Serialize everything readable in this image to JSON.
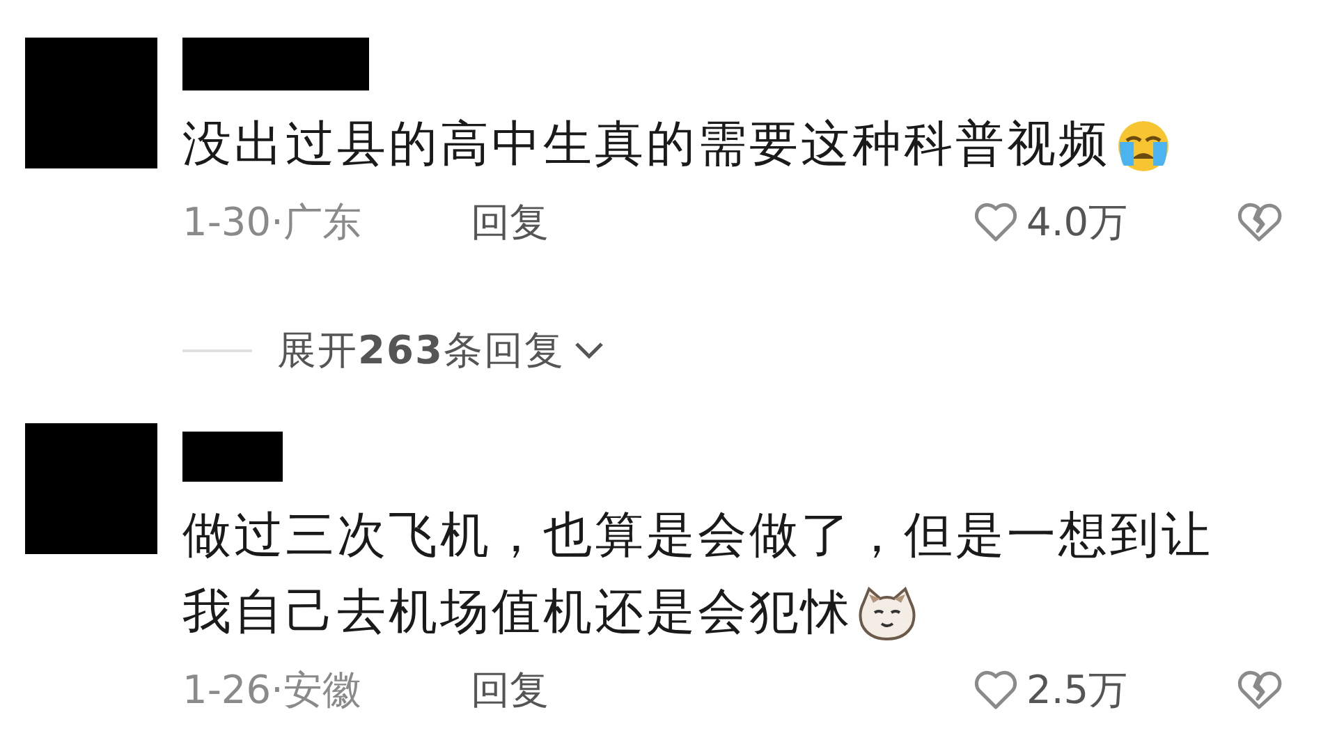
{
  "comments": [
    {
      "text": [
        "没出过县的高中生真的需要这种科普视频"
      ],
      "kind": "crying",
      "meta": "1-30·广东",
      "reply": "回复",
      "likes": "4.0万",
      "expand": "展开**263**条回复"
    },
    {
      "text": [
        "做过三次飞机，也算是会做了，但是一想到让",
        "我自己去机场值机还是会犯怵"
      ],
      "kind": "cat",
      "meta": "1-26·安徽",
      "reply": "回复",
      "likes": "2.5万"
    }
  ]
}
